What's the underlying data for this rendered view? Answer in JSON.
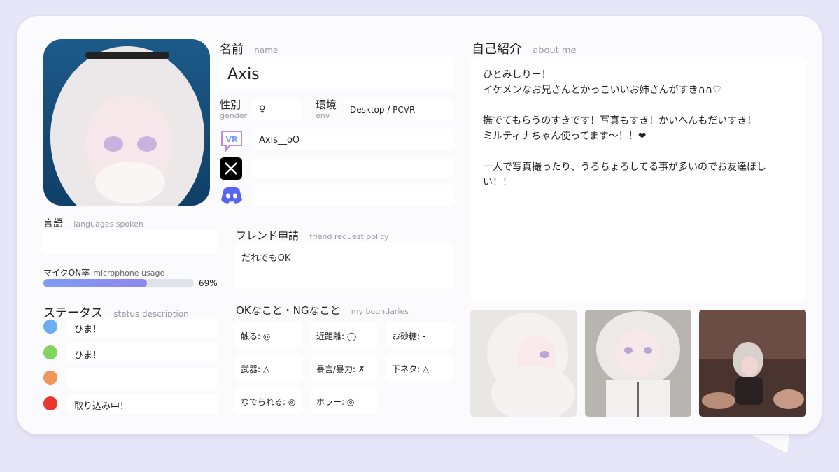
{
  "name": {
    "label_jp": "名前",
    "label_en": "name",
    "value": "Axis"
  },
  "gender": {
    "label_jp": "性別",
    "label_en": "gender",
    "value": "♀"
  },
  "env": {
    "label_jp": "環境",
    "label_en": "env",
    "value": "Desktop / PCVR"
  },
  "accounts": {
    "vrchat": {
      "icon": "vrchat-icon",
      "value": "Axis__oO"
    },
    "x": {
      "icon": "x-icon",
      "value": ""
    },
    "discord": {
      "icon": "discord-icon",
      "value": ""
    }
  },
  "languages": {
    "label_jp": "言語",
    "label_en": "languages spoken",
    "value": ""
  },
  "mic": {
    "label_jp": "マイクON率",
    "label_en": "microphone usage",
    "percent": 69,
    "percent_text": "69%"
  },
  "status": {
    "label_jp": "ステータス",
    "label_en": "status description",
    "items": [
      {
        "color": "#6aaef0",
        "text": "ひま！"
      },
      {
        "color": "#7fd35e",
        "text": "ひま！"
      },
      {
        "color": "#f0965a",
        "text": ""
      },
      {
        "color": "#e8382f",
        "text": "取り込み中！"
      }
    ]
  },
  "friend": {
    "label_jp": "フレンド申請",
    "label_en": "friend request policy",
    "value": "だれでもOK"
  },
  "boundaries": {
    "label_jp": "OKなこと・NGなこと",
    "label_en": "my boundaries",
    "items": [
      "触る: ◎",
      "近距離: ◯",
      "お砂糖: -",
      "武器: △",
      "暴言/暴力: ✗",
      "下ネタ: △",
      "なでられる: ◎",
      "ホラー: ◎"
    ]
  },
  "about": {
    "label_jp": "自己紹介",
    "label_en": "about me",
    "text": "ひとみしりー！\nイケメンなお兄さんとかっこいいお姉さんがすき∩∩♡\n\n撫でてもらうのすきです！写真もすき！かいへんもだいすき！\nミルティナちゃん使ってます〜！！❤\n\n一人で写真撮ったり、うろちょろしてる事が多いのでお友達ほしい！！"
  },
  "colors": {
    "background": "#e6e6f8",
    "card": "#fbfbfe",
    "mic_bar": "#8a94ef"
  }
}
